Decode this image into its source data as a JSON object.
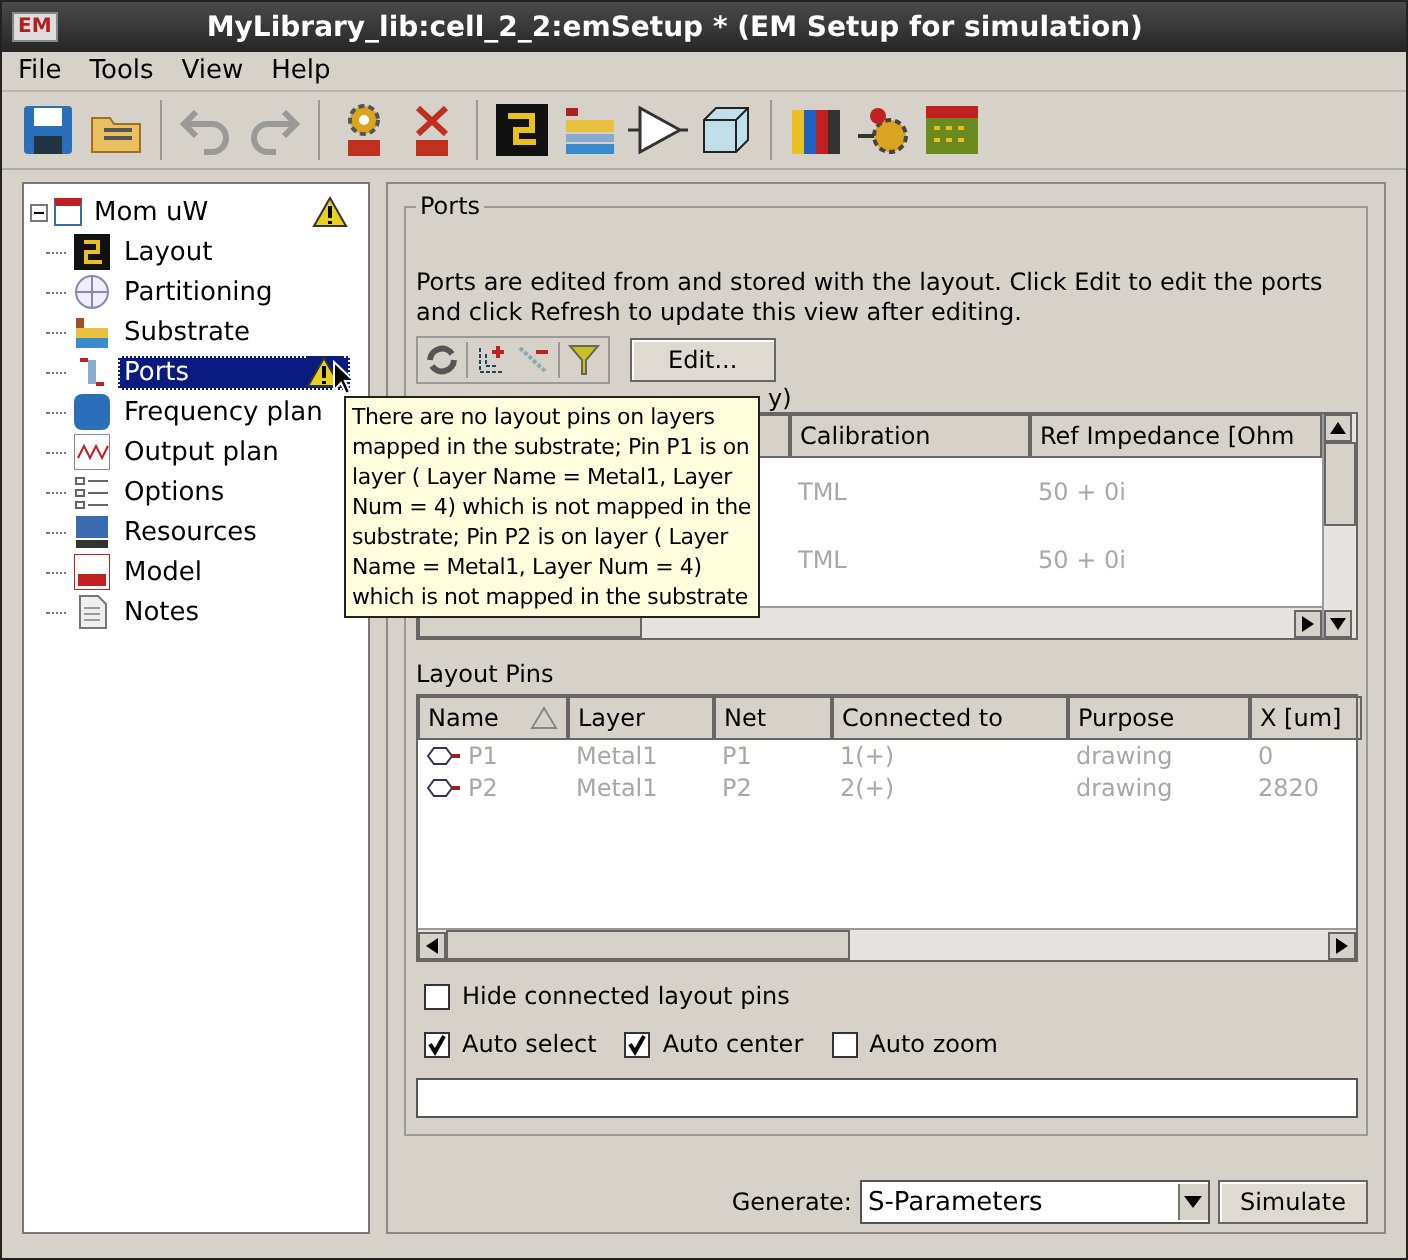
{
  "window": {
    "title": "MyLibrary_lib:cell_2_2:emSetup * (EM Setup for simulation)",
    "logo": "EM"
  },
  "menu": [
    "File",
    "Tools",
    "View",
    "Help"
  ],
  "tree": {
    "label": "Mom uW",
    "expanded": true,
    "warning": true,
    "children": [
      {
        "label": "Layout",
        "selected": false,
        "warning": false
      },
      {
        "label": "Partitioning",
        "selected": false,
        "warning": false
      },
      {
        "label": "Substrate",
        "selected": false,
        "warning": false
      },
      {
        "label": "Ports",
        "selected": true,
        "warning": true
      },
      {
        "label": "Frequency plan",
        "selected": false,
        "warning": false
      },
      {
        "label": "Output plan",
        "selected": false,
        "warning": false
      },
      {
        "label": "Options",
        "selected": false,
        "warning": false
      },
      {
        "label": "Resources",
        "selected": false,
        "warning": false
      },
      {
        "label": "Model",
        "selected": false,
        "warning": false
      },
      {
        "label": "Notes",
        "selected": false,
        "warning": false
      }
    ]
  },
  "tooltip": "There are no layout pins on layers mapped in the substrate; Pin P1 is on layer ( Layer Name = Metal1, Layer Num = 4) which is not mapped in the substrate; Pin P2 is on layer ( Layer Name = Metal1, Layer Num = 4) which is not mapped in the substrate",
  "ports": {
    "title": "Ports",
    "description": "Ports are edited from and stored with the layout. Click Edit to edit the ports and click Refresh to update this view after editing.",
    "edit_button": "Edit...",
    "table_caption": "y)",
    "table": {
      "columns": [
        "Calibration",
        "Ref Impedance [Ohm"
      ],
      "rows": [
        [
          "TML",
          "50 + 0i"
        ],
        [
          "TML",
          "50 + 0i"
        ]
      ]
    }
  },
  "layout_pins": {
    "title": "Layout Pins",
    "columns": [
      {
        "label": "Name",
        "sorted": true
      },
      {
        "label": "Layer",
        "sorted": false
      },
      {
        "label": "Net",
        "sorted": false
      },
      {
        "label": "Connected to",
        "sorted": false
      },
      {
        "label": "Purpose",
        "sorted": false
      },
      {
        "label": "X [um]",
        "sorted": false
      }
    ],
    "rows": [
      {
        "disabled": true,
        "cells": [
          "P1",
          "Metal1",
          "P1",
          "1(+)",
          "drawing",
          "0"
        ]
      },
      {
        "disabled": true,
        "cells": [
          "P2",
          "Metal1",
          "P2",
          "2(+)",
          "drawing",
          "2820"
        ]
      }
    ]
  },
  "hide_connected": {
    "label": "Hide connected layout pins",
    "checked": false
  },
  "options": [
    {
      "label": "Auto select",
      "checked": true
    },
    {
      "label": "Auto center",
      "checked": true
    },
    {
      "label": "Auto zoom",
      "checked": false
    }
  ],
  "generate": {
    "label": "Generate:",
    "value": "S-Parameters"
  },
  "simulate_button": "Simulate"
}
